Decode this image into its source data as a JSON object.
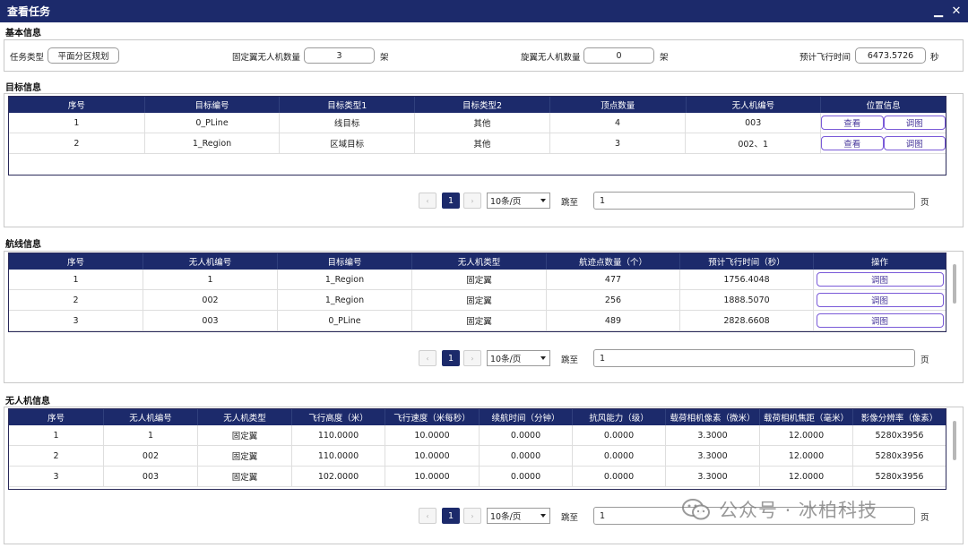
{
  "window": {
    "title": "查看任务",
    "minimize_icon": "minimize-icon",
    "close_icon": "close-icon"
  },
  "basic": {
    "section_title": "基本信息",
    "task_type_label": "任务类型",
    "task_type_value": "平面分区规划",
    "fixed_wing_label": "固定翼无人机数量",
    "fixed_wing_value": "3",
    "fixed_wing_unit": "架",
    "rotor_label": "旋翼无人机数量",
    "rotor_value": "0",
    "rotor_unit": "架",
    "flight_time_label": "预计飞行时间",
    "flight_time_value": "6473.5726",
    "flight_time_unit": "秒"
  },
  "targets": {
    "section_title": "目标信息",
    "columns": [
      "序号",
      "目标编号",
      "目标类型1",
      "目标类型2",
      "顶点数量",
      "无人机编号",
      "位置信息"
    ],
    "rows": [
      [
        "1",
        "0_PLine",
        "线目标",
        "其他",
        "4",
        "003"
      ],
      [
        "2",
        "1_Region",
        "区域目标",
        "其他",
        "3",
        "002、1"
      ]
    ],
    "view_label": "查看",
    "adjust_label": "调图"
  },
  "routes": {
    "section_title": "航线信息",
    "columns": [
      "序号",
      "无人机编号",
      "目标编号",
      "无人机类型",
      "航迹点数量（个）",
      "预计飞行时间（秒）",
      "操作"
    ],
    "rows": [
      [
        "1",
        "1",
        "1_Region",
        "固定翼",
        "477",
        "1756.4048"
      ],
      [
        "2",
        "002",
        "1_Region",
        "固定翼",
        "256",
        "1888.5070"
      ],
      [
        "3",
        "003",
        "0_PLine",
        "固定翼",
        "489",
        "2828.6608"
      ]
    ],
    "adjust_label": "调图"
  },
  "drones": {
    "section_title": "无人机信息",
    "columns": [
      "序号",
      "无人机编号",
      "无人机类型",
      "飞行高度（米）",
      "飞行速度（米每秒）",
      "续航时间（分钟）",
      "抗风能力（级）",
      "载荷相机像素（微米）",
      "载荷相机焦距（毫米）",
      "影像分辨率（像素）"
    ],
    "rows": [
      [
        "1",
        "1",
        "固定翼",
        "110.0000",
        "10.0000",
        "0.0000",
        "0.0000",
        "3.3000",
        "12.0000",
        "5280x3956"
      ],
      [
        "2",
        "002",
        "固定翼",
        "110.0000",
        "10.0000",
        "0.0000",
        "0.0000",
        "3.3000",
        "12.0000",
        "5280x3956"
      ],
      [
        "3",
        "003",
        "固定翼",
        "102.0000",
        "10.0000",
        "0.0000",
        "0.0000",
        "3.3000",
        "12.0000",
        "5280x3956"
      ]
    ]
  },
  "pager": {
    "prev": "‹",
    "next": "›",
    "current_page": "1",
    "page_size": "10条/页",
    "jump_label": "跳至",
    "jump_value": "1",
    "page_unit": "页"
  },
  "watermark": {
    "text": "公众号 · 冰柏科技",
    "icon": "wechat-icon"
  }
}
